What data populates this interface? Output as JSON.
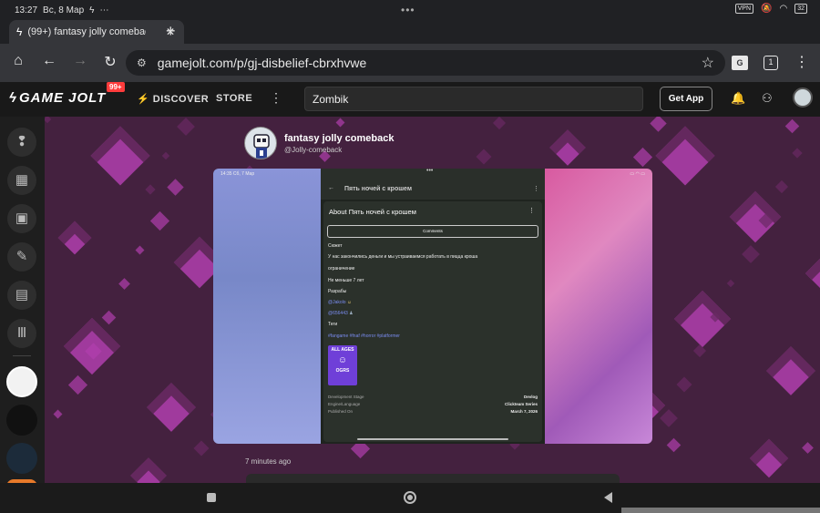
{
  "status_bar": {
    "time": "13:27",
    "date": "Вс, 8 Мар",
    "vpn_label": "VPN",
    "battery": "32"
  },
  "browser": {
    "tab_title": "(99+) fantasy jolly comeback",
    "url": "gamejolt.com/p/gj-disbelief-cbrxhvwe",
    "tab_count": "1"
  },
  "gamejolt": {
    "logo_text": "GAME JOLT",
    "notification_count": "99+",
    "nav": {
      "discover": "DISCOVER",
      "store": "STORE"
    },
    "search_value": "Zombik",
    "get_app": "Get App"
  },
  "post": {
    "author_name": "fantasy jolly comeback",
    "author_handle": "@Jolly-comeback",
    "timestamp": "7 minutes ago"
  },
  "screenshot": {
    "status_time": "14:35",
    "status_date": "Сб, 7 Мар",
    "page_title": "Пять ночей с крошем",
    "modal_title_prefix": "About",
    "modal_title": "Пять ночей с крошем",
    "comments_button": "Comments",
    "lines": {
      "heading": "Сюжет",
      "plot": "У нас закончились деньги и мы устраиваемся работать в пицца кроша",
      "restriction": "ограничение",
      "age": "Не меньше 7 лет",
      "devs_label": "Разрабы",
      "dev1": "@Jakolo",
      "dev2": "@656443",
      "tags_label": "Теги",
      "tags": "#fangame #fnaf #horror #platformer"
    },
    "rating": {
      "top": "ALL AGES",
      "bottom": "OGRS"
    },
    "meta": [
      {
        "label": "Development Stage",
        "value": "Devlog"
      },
      {
        "label": "Engine/Language",
        "value": "Clickteam Series"
      },
      {
        "label": "Published On",
        "value": "March 7, 2026"
      }
    ]
  },
  "colors": {
    "page_bg": "#44213f",
    "diamond_light": "#b13fae",
    "diamond_dark": "#6a2a64",
    "accent_badge": "#ff3c3c"
  }
}
